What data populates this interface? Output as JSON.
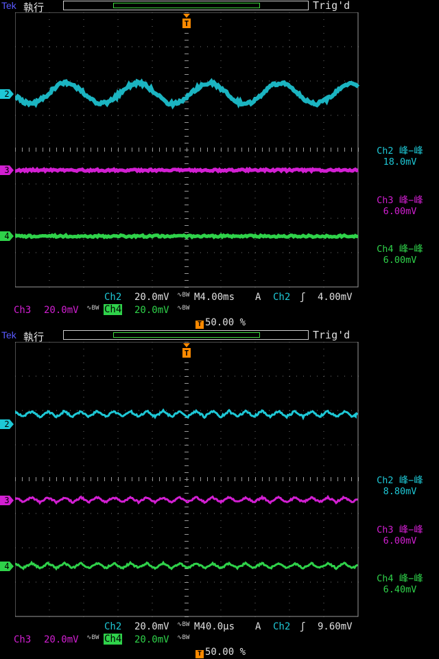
{
  "screens": [
    {
      "brand": "Tek",
      "state": "執行",
      "trig_status": "Trig'd",
      "trigger_marker": "T",
      "meas": [
        {
          "label": "Ch2 峰−峰",
          "value": "18.0mV",
          "color": "#1ec8d6"
        },
        {
          "label": "Ch3 峰−峰",
          "value": "6.00mV",
          "color": "#d21fd2"
        },
        {
          "label": "Ch4 峰−峰",
          "value": "6.00mV",
          "color": "#2fd24a"
        }
      ],
      "ch2_label": "Ch2",
      "ch2_scale": "20.0mV",
      "ch3_label": "Ch3",
      "ch3_scale": "20.0mV",
      "ch4_label": "Ch4",
      "ch4_scale": "20.0mV",
      "bw_mark": "BW",
      "timebase": "M4.00ms",
      "trig_mode": "A",
      "trig_source": "Ch2",
      "trig_level": "4.00mV",
      "trig_position": "50.00 %",
      "markers": [
        "2",
        "3",
        "4"
      ]
    },
    {
      "brand": "Tek",
      "state": "執行",
      "trig_status": "Trig'd",
      "trigger_marker": "T",
      "meas": [
        {
          "label": "Ch2 峰−峰",
          "value": "8.80mV",
          "color": "#1ec8d6"
        },
        {
          "label": "Ch3 峰−峰",
          "value": "6.00mV",
          "color": "#d21fd2"
        },
        {
          "label": "Ch4 峰−峰",
          "value": "6.40mV",
          "color": "#2fd24a"
        }
      ],
      "ch2_label": "Ch2",
      "ch2_scale": "20.0mV",
      "ch3_label": "Ch3",
      "ch3_scale": "20.0mV",
      "ch4_label": "Ch4",
      "ch4_scale": "20.0mV",
      "bw_mark": "BW",
      "timebase": "M40.0µs",
      "trig_mode": "A",
      "trig_source": "Ch2",
      "trig_level": "9.60mV",
      "trig_position": "50.00 %",
      "markers": [
        "2",
        "3",
        "4"
      ]
    }
  ],
  "colors": {
    "ch2": "#1ec8d6",
    "ch3": "#d21fd2",
    "ch4": "#2fd24a",
    "trigger": "#ff8a00"
  }
}
